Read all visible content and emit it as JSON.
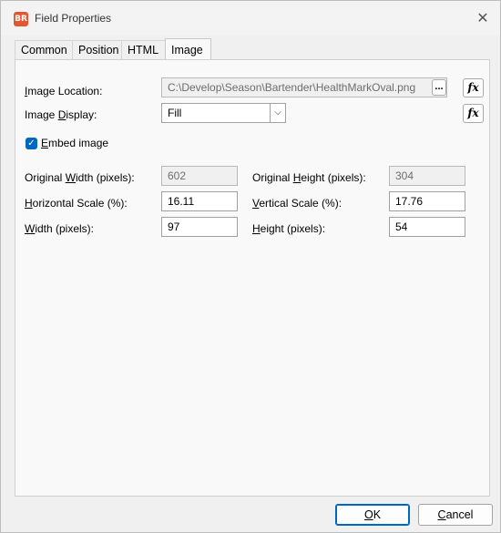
{
  "window": {
    "title": "Field Properties",
    "app_icon_text": "BR",
    "close_glyph": "✕"
  },
  "tabs": [
    {
      "label": "Common",
      "active": false
    },
    {
      "label": "Position",
      "active": false
    },
    {
      "label": "HTML",
      "active": false
    },
    {
      "label": "Image",
      "active": true
    }
  ],
  "image_tab": {
    "image_location": {
      "label_pre": "",
      "label_u": "I",
      "label_post": "mage Location:",
      "value": "C:\\Develop\\Season\\Bartender\\HealthMarkOval.png",
      "browse_label": "...",
      "fx_label": "fx"
    },
    "image_display": {
      "label_pre": "Image ",
      "label_u": "D",
      "label_post": "isplay:",
      "value": "Fill",
      "fx_label": "fx",
      "arrow": "⌵"
    },
    "embed_image": {
      "label_pre": "",
      "label_u": "E",
      "label_post": "mbed image",
      "checked": true,
      "check_glyph": "✓"
    },
    "original_width": {
      "label_pre": "Original ",
      "label_u": "W",
      "label_post": "idth (pixels):",
      "value": "602"
    },
    "original_height": {
      "label_pre": "Original ",
      "label_u": "H",
      "label_post": "eight (pixels):",
      "value": "304"
    },
    "horizontal_scale": {
      "label_pre": "",
      "label_u": "H",
      "label_post": "orizontal Scale (%):",
      "value": "16.11"
    },
    "vertical_scale": {
      "label_pre": "",
      "label_u": "V",
      "label_post": "ertical Scale (%):",
      "value": "17.76"
    },
    "width": {
      "label_pre": "",
      "label_u": "W",
      "label_post": "idth (pixels):",
      "value": "97"
    },
    "height": {
      "label_pre": "",
      "label_u": "H",
      "label_post": "eight (pixels):",
      "value": "54"
    }
  },
  "footer": {
    "ok_u": "O",
    "ok_post": "K",
    "cancel_u": "C",
    "cancel_post": "ancel"
  },
  "colors": {
    "accent": "#0067c0",
    "app_icon": "#e4572e"
  }
}
